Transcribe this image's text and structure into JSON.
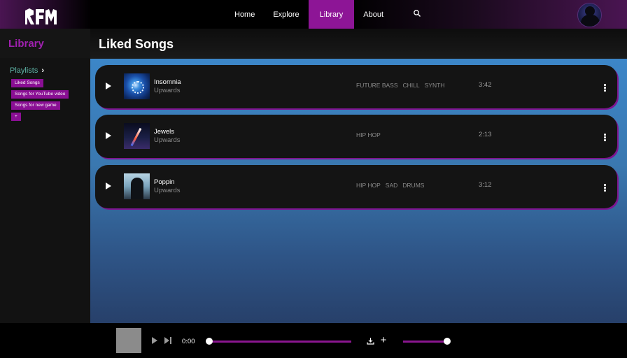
{
  "app": {
    "logo_text": "RFM"
  },
  "nav": {
    "items": [
      {
        "label": "Home"
      },
      {
        "label": "Explore"
      },
      {
        "label": "Library",
        "active": true
      },
      {
        "label": "About"
      }
    ],
    "search_icon": "search-icon"
  },
  "sidebar": {
    "title": "Library",
    "playlists_label": "Playlists",
    "playlists": [
      "Liked Songs",
      "Songs for YouTube video",
      "Songs for new game",
      "+"
    ]
  },
  "main": {
    "title": "Liked Songs",
    "tracks": [
      {
        "name": "Insomnia",
        "artist": "Upwards",
        "tags": [
          "FUTURE BASS",
          "CHILL",
          "SYNTH"
        ],
        "duration": "3:42"
      },
      {
        "name": "Jewels",
        "artist": "Upwards",
        "tags": [
          "HIP HOP"
        ],
        "duration": "2:13"
      },
      {
        "name": "Poppin",
        "artist": "Upwards",
        "tags": [
          "HIP HOP",
          "SAD",
          "DRUMS"
        ],
        "duration": "3:12"
      }
    ]
  },
  "player": {
    "time": "0:00",
    "progress": 0,
    "volume": 1.0
  },
  "colors": {
    "accent": "#8d1596",
    "sidebar_title": "#a020b0",
    "playlists_label": "#5fb6a8",
    "content_gradient_top": "#3c86c8",
    "content_gradient_bottom": "#27406a"
  }
}
